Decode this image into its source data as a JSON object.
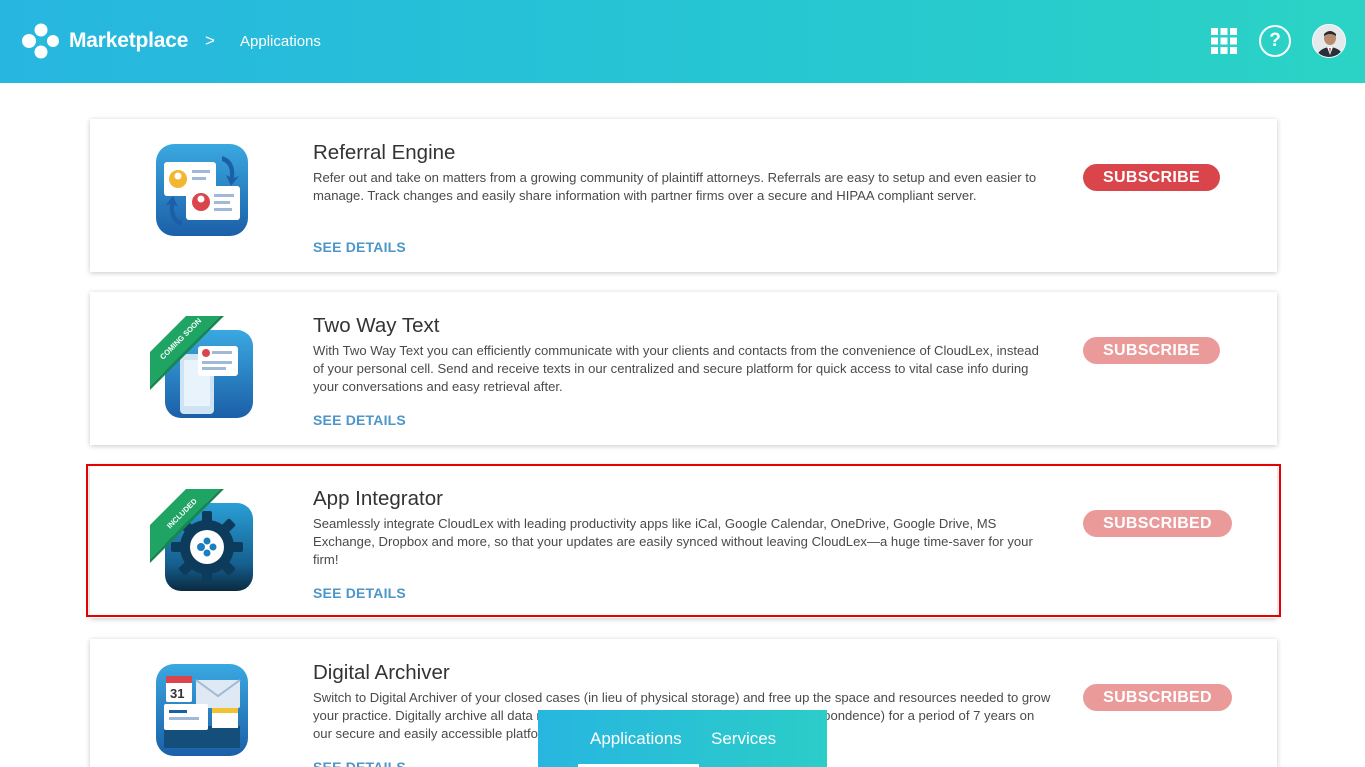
{
  "header": {
    "brand": "Marketplace",
    "breadcrumb_separator": ">",
    "breadcrumb_current": "Applications",
    "icons": [
      "logo-icon",
      "apps-grid-icon",
      "help-icon",
      "avatar"
    ],
    "help_glyph": "?"
  },
  "colors": {
    "header_gradient_start": "#27b6e0",
    "header_gradient_end": "#2bd3c5",
    "subscribe_active": "#d9454a",
    "subscribe_muted": "#eb9a9a",
    "link": "#4d96c9",
    "highlight_border": "#e60000",
    "ribbon": "#1fa463"
  },
  "apps": [
    {
      "title": "Referral Engine",
      "description": "Refer out and take on matters from a growing community of plaintiff attorneys. Referrals are easy to setup and even easier to manage. Track changes and easily share information with partner firms over a secure and HIPAA compliant server.",
      "details_label": "SEE DETAILS",
      "button_label": "SUBSCRIBE",
      "ribbon": ""
    },
    {
      "title": "Two Way Text",
      "description": "With Two Way Text you can efficiently communicate with your clients and contacts from the convenience of CloudLex, instead of your personal cell. Send and receive texts in our centralized and secure platform for quick access to vital case info during your conversations and easy retrieval after.",
      "details_label": "SEE DETAILS",
      "button_label": "SUBSCRIBE",
      "ribbon": "COMING SOON"
    },
    {
      "title": "App Integrator",
      "description": "Seamlessly integrate CloudLex with leading productivity apps like iCal, Google Calendar, OneDrive, Google Drive, MS Exchange, Dropbox and more, so that your updates are easily synced without leaving CloudLex—a huge time-saver for your firm!",
      "details_label": "SEE DETAILS",
      "button_label": "SUBSCRIBED",
      "ribbon": "INCLUDED"
    },
    {
      "title": "Digital Archiver",
      "description": "Switch to Digital Archiver of your closed cases (in lieu of physical storage) and free up the space and resources needed to grow your practice. Digitally archive all data related to your closed matters (even digital correspondence) for a period of 7 years on our secure and easily accessible platform.",
      "details_label": "SEE DETAILS",
      "button_label": "SUBSCRIBED",
      "ribbon": "",
      "calendar_day": "31"
    }
  ],
  "bottom_tabs": {
    "applications": "Applications",
    "services": "Services",
    "active": "Applications"
  }
}
